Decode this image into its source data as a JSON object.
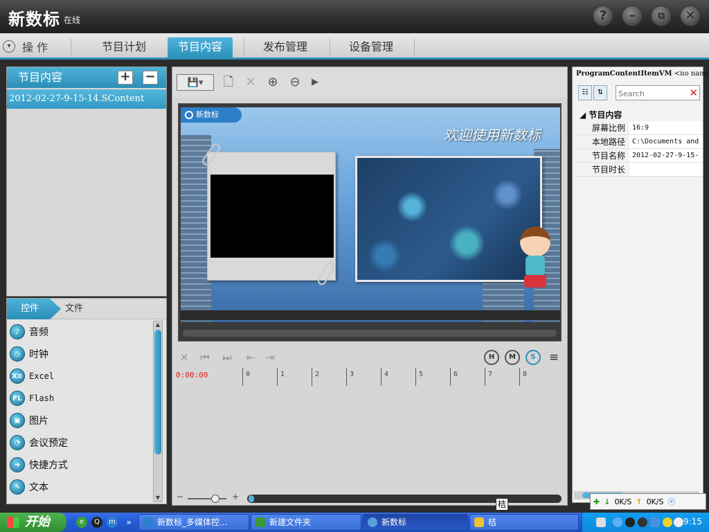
{
  "window": {
    "title": "新数标",
    "status": "在线",
    "buttons": {
      "help": "?",
      "minimize": "–",
      "restore": "⧉",
      "close": "✕"
    }
  },
  "menu": {
    "ops_label": "操 作",
    "tabs": [
      {
        "label": "节目计划"
      },
      {
        "label": "节目内容",
        "active": true
      },
      {
        "label": "发布管理"
      },
      {
        "label": "设备管理"
      }
    ]
  },
  "content_panel": {
    "header": "节目内容",
    "add_label": "+",
    "remove_label": "−",
    "items": [
      "2012-02-27-9-15-14.SContent"
    ]
  },
  "control_panel": {
    "tabs": [
      {
        "label": "控件",
        "active": true
      },
      {
        "label": "文件"
      }
    ],
    "items": [
      {
        "label": "音频",
        "icon": "audio-icon",
        "glyph": "♪"
      },
      {
        "label": "时钟",
        "icon": "clock-icon",
        "glyph": "◷"
      },
      {
        "label": "Excel",
        "icon": "excel-icon",
        "glyph": "X≡"
      },
      {
        "label": "Flash",
        "icon": "flash-icon",
        "glyph": "FL"
      },
      {
        "label": "图片",
        "icon": "picture-icon",
        "glyph": "▣"
      },
      {
        "label": "会议预定",
        "icon": "meeting-icon",
        "glyph": "◔"
      },
      {
        "label": "快捷方式",
        "icon": "shortcut-icon",
        "glyph": "➜"
      },
      {
        "label": "文本",
        "icon": "text-icon",
        "glyph": "✎"
      }
    ]
  },
  "editor": {
    "toolbar": {
      "save": "💾▾",
      "new": "🗋",
      "delete": "✕",
      "zoom_in": "⊕",
      "zoom_out": "⊖",
      "play": "▶"
    },
    "canvas": {
      "badge": "新数标",
      "welcome_text": "欢迎使用新数标"
    },
    "transport": {
      "close": "✕",
      "prev": "⏮",
      "next": "⏭",
      "indent_left": "⇤",
      "indent_right": "⇥",
      "hour": "H",
      "minute": "M",
      "second": "S",
      "menu": "≡"
    },
    "timeline": {
      "time": "0:00:00",
      "ticks": [
        "0",
        "1",
        "2",
        "3",
        "4",
        "5",
        "6",
        "7",
        "8"
      ]
    },
    "zoom": {
      "minus": "−",
      "plus": "+"
    }
  },
  "properties": {
    "title_bold": "ProgramContentItemVM",
    "title_rest": " <no name>",
    "search_placeholder": "Search",
    "category": "节目内容",
    "rows": [
      {
        "key": "屏幕比例",
        "value": "16:9"
      },
      {
        "key": "本地路径",
        "value": "C:\\Documents and"
      },
      {
        "key": "节目名称",
        "value": "2012-02-27-9-15-"
      },
      {
        "key": "节目时长",
        "value": ""
      }
    ]
  },
  "net_monitor": {
    "down": "0K/S",
    "up": "0K/S"
  },
  "tooltip": "桔",
  "taskbar": {
    "start": "开始",
    "tasks": [
      {
        "label": "新数标_多媒体控...",
        "active": false
      },
      {
        "label": "新建文件夹",
        "active": false
      },
      {
        "label": "新数标",
        "active": true
      },
      {
        "label": "桔",
        "active": false
      }
    ],
    "clock": "9:15"
  }
}
